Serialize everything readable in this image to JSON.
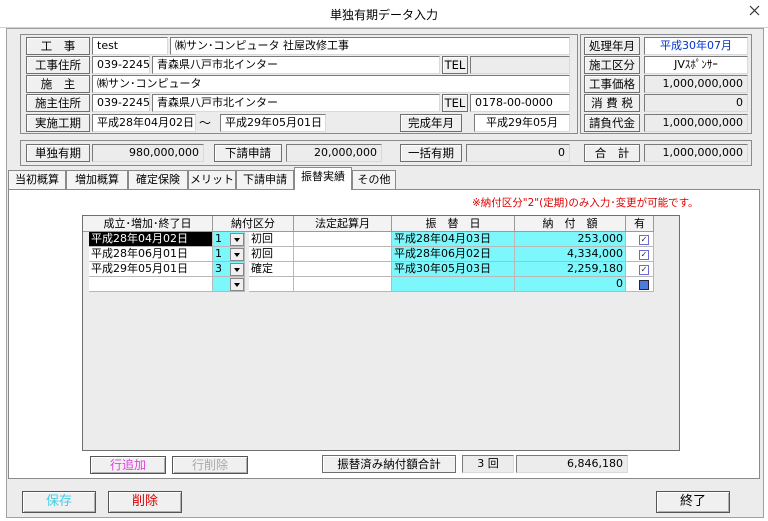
{
  "window": {
    "title": "単独有期データ入力"
  },
  "header": {
    "koji_label": "工　事",
    "koji_code": "test",
    "koji_name": "㈱サン･コンピュータ 社屋改修工事",
    "koji_addr_label": "工事住所",
    "koji_zip": "039-2245",
    "koji_addr": "青森県八戸市北インター",
    "tel_label": "TEL",
    "koji_tel": "",
    "sekou_label": "施　主",
    "sekou_name": "㈱サン･コンピュータ",
    "sekou_addr_label": "施主住所",
    "sekou_zip": "039-2245",
    "sekou_addr": "青森県八戸市北インター",
    "tel2_label": "TEL",
    "sekou_tel": "0178-00-0000",
    "period_label": "実施工期",
    "period_start": "平成28年04月02日",
    "tilde": "～",
    "period_end": "平成29年05月01日",
    "complete_label": "完成年月",
    "complete_value": "平成29年05月"
  },
  "right": {
    "shori_label": "処理年月",
    "shori_value": "平成30年07月",
    "kubun_label": "施工区分",
    "kubun_value": "JVｽﾎﾟﾝｻｰ",
    "price_label": "工事価格",
    "price_value": "1,000,000,000",
    "tax_label": "消 費 税",
    "tax_value": "0",
    "claim_label": "請負代金",
    "claim_value": "1,000,000,000"
  },
  "summary": {
    "tandoku_label": "単独有期",
    "tandoku_value": "980,000,000",
    "shitauke_label": "下請申請",
    "shitauke_value": "20,000,000",
    "ikkatsu_label": "一括有期",
    "ikkatsu_value": "0",
    "total_label": "合　計",
    "total_value": "1,000,000,000"
  },
  "tabs": [
    "当初概算",
    "増加概算",
    "確定保険",
    "メリット",
    "下請申請",
    "振替実績",
    "その他"
  ],
  "note": "※納付区分\"2\"(定期)のみ入力･変更が可能です。",
  "grid": {
    "headers": [
      "成立･増加･終了日",
      "納付区分",
      "法定起算月",
      "振　替　日",
      "納　付　額",
      "有"
    ],
    "rows": [
      {
        "date": "平成28年04月02日",
        "kubun": "1",
        "kubun_name": "初回",
        "kisan": "",
        "furikae": "平成28年04月03日",
        "amount": "253,000",
        "checked": "✓"
      },
      {
        "date": "平成28年06月01日",
        "kubun": "1",
        "kubun_name": "初回",
        "kisan": "",
        "furikae": "平成28年06月02日",
        "amount": "4,334,000",
        "checked": "✓"
      },
      {
        "date": "平成29年05月01日",
        "kubun": "3",
        "kubun_name": "確定",
        "kisan": "",
        "furikae": "平成30年05月03日",
        "amount": "2,259,180",
        "checked": "✓"
      },
      {
        "date": "",
        "kubun": "",
        "kubun_name": "",
        "kisan": "",
        "furikae": "",
        "amount": "0",
        "checked": ""
      }
    ]
  },
  "grid_footer": {
    "add_label": "行追加",
    "del_label": "行削除",
    "sum_label": "振替済み納付額合計",
    "count": "3",
    "count_unit": "回",
    "sum_value": "6,846,180"
  },
  "footer": {
    "save_label": "保存",
    "delete_label": "削除",
    "exit_label": "終了"
  },
  "colors": {
    "cyan": "#7cf7fb",
    "blue_text": "#0033cc",
    "red_text": "#e00000",
    "pink_text": "#e040e0"
  }
}
